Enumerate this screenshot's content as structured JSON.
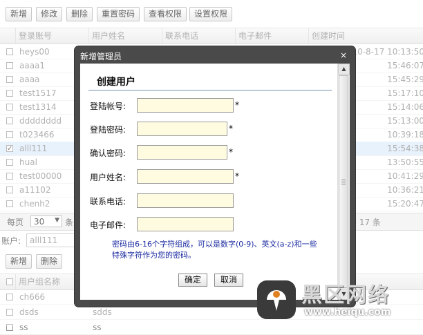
{
  "toolbar": {
    "add": "新增",
    "edit": "修改",
    "delete": "删除",
    "reset_password": "重置密码",
    "view_permissions": "查看权限",
    "set_permissions": "设置权限"
  },
  "grid": {
    "columns": [
      "登录账号",
      "用户姓名",
      "联系电话",
      "电子邮件",
      "创建时间"
    ],
    "rows": [
      {
        "account": "heys00",
        "time": "2010-8-17 10:13:50",
        "checked": false
      },
      {
        "account": "aaaa1",
        "time": "15:46:07",
        "checked": false
      },
      {
        "account": "aaaa",
        "time": "15:45:29",
        "checked": false
      },
      {
        "account": "test1517",
        "time": "15:17:10",
        "checked": false
      },
      {
        "account": "test1314",
        "time": "15:14:06",
        "checked": false
      },
      {
        "account": "dddddddd",
        "time": "15:13:00",
        "checked": false
      },
      {
        "account": "t023466",
        "time": "10:39:18",
        "checked": false
      },
      {
        "account": "alll111",
        "time": "15:54:38",
        "checked": true
      },
      {
        "account": "hual",
        "time": "13:50:55",
        "checked": false
      },
      {
        "account": "test00000",
        "time": "10:41:29",
        "checked": false
      },
      {
        "account": "a11102",
        "time": "10:36:21",
        "checked": false
      },
      {
        "account": "chenh2",
        "time": "15:20:47",
        "checked": false
      }
    ]
  },
  "pager": {
    "per_page_label": "每页",
    "per_page_value": "30",
    "tail": "条",
    "total": "共 17 条"
  },
  "account_field": {
    "label": "账户:",
    "value": "alll111"
  },
  "toolbar2": {
    "add": "新增",
    "delete": "删除"
  },
  "grid2": {
    "column": "用户组名称",
    "rows": [
      {
        "name": "ch666",
        "desc": ""
      },
      {
        "name": "dsds",
        "desc": "sdds"
      },
      {
        "name": "ss",
        "desc": "ss"
      }
    ]
  },
  "dialog": {
    "title": "新增管理员",
    "close": "×",
    "heading": "创建用户",
    "fields": [
      {
        "label": "登陆帐号:",
        "required": "*"
      },
      {
        "label": "登陆密码:",
        "required": "*"
      },
      {
        "label": "确认密码:",
        "required": "*"
      },
      {
        "label": "用户姓名:",
        "required": "*"
      },
      {
        "label": "联系电话:",
        "required": ""
      },
      {
        "label": "电子邮件:",
        "required": ""
      }
    ],
    "note": "密码由6-16个字符组成，可以是数字(0-9)、英文(a-z)和一些特殊字符作为您的密码。",
    "ok": "确定",
    "cancel": "取消"
  },
  "watermark": {
    "brand": "黑区网络",
    "url": "www.heiqu.com"
  },
  "colors": {
    "selected_row": "#dcebfa",
    "input_bg": "#fffbe0",
    "dialog_frame": "#4a4a4a",
    "note_text": "#1a2aa0"
  }
}
